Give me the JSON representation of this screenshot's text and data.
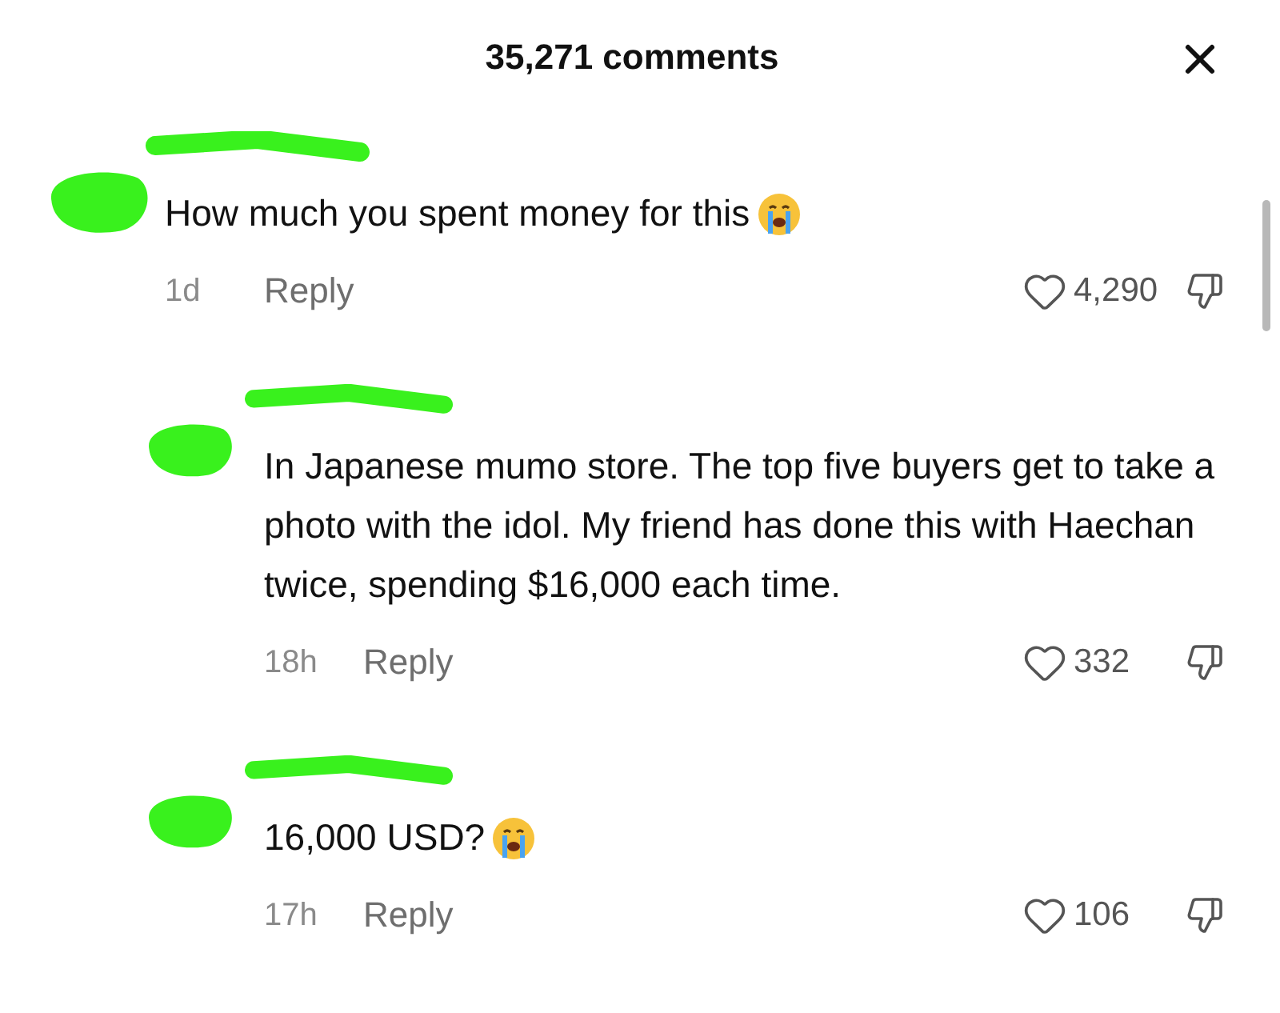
{
  "header": {
    "title": "35,271 comments"
  },
  "comments": [
    {
      "text": "How much you spent money for this",
      "emoji": true,
      "time": "1d",
      "reply": "Reply",
      "likes": "4,290",
      "children": [
        {
          "text": "In Japanese mumo store. The top five buyers get to take a photo with the idol. My friend has done this with Haechan twice, spending $16,000 each time.",
          "emoji": false,
          "time": "18h",
          "reply": "Reply",
          "likes": "332"
        },
        {
          "text": "16,000 USD?",
          "emoji": true,
          "time": "17h",
          "reply": "Reply",
          "likes": "106"
        }
      ]
    }
  ]
}
